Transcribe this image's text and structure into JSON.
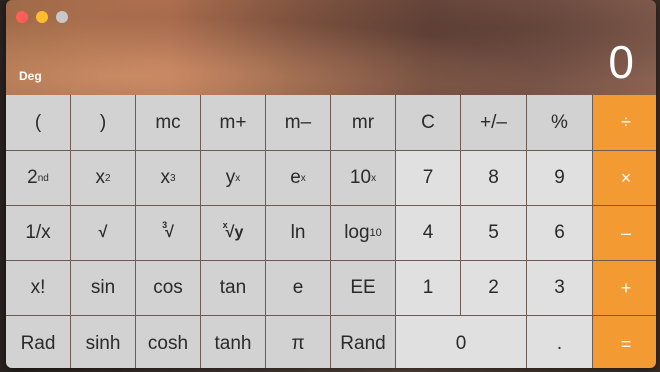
{
  "window": {
    "traffic_lights": [
      "close",
      "minimize",
      "zoom"
    ]
  },
  "display": {
    "mode": "Deg",
    "value": "0"
  },
  "keys": {
    "r1": [
      "(",
      ")",
      "mc",
      "m+",
      "m–",
      "mr",
      "C",
      "+/–",
      "%",
      "÷"
    ],
    "r2": [
      "2",
      "nd",
      "x",
      "2",
      "x",
      "3",
      "y",
      "x",
      "e",
      "x",
      "10",
      "x",
      "7",
      "8",
      "9",
      "×"
    ],
    "r3": [
      "1/x",
      "√",
      "3",
      "√",
      "x",
      "√",
      "y",
      "ln",
      "log",
      "10",
      "4",
      "5",
      "6",
      "–"
    ],
    "r4": [
      "x!",
      "sin",
      "cos",
      "tan",
      "e",
      "EE",
      "1",
      "2",
      "3",
      "+"
    ],
    "r5": [
      "Rad",
      "sinh",
      "cosh",
      "tanh",
      "π",
      "Rand",
      "0",
      ".",
      "="
    ]
  },
  "colors": {
    "operator": "#f39a33",
    "scientific_key": "#d2d2d2",
    "number_key": "#e0e0e0",
    "text": "#2a2a2a"
  }
}
